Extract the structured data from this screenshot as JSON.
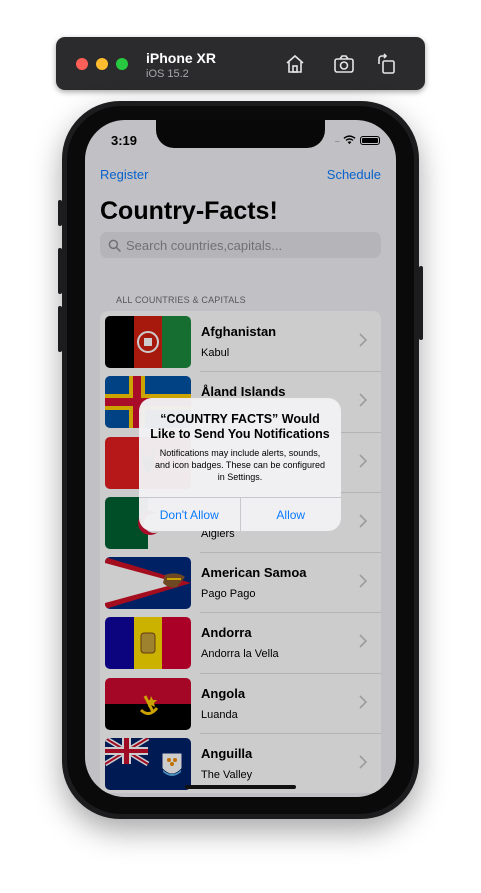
{
  "simulator": {
    "device": "iPhone XR",
    "os": "iOS 15.2",
    "icons": [
      "home-icon",
      "screenshot-icon",
      "rotate-icon"
    ]
  },
  "status_bar": {
    "time": "3:19",
    "signal": "....."
  },
  "nav": {
    "left": "Register",
    "right": "Schedule"
  },
  "title": "Country-Facts!",
  "search": {
    "placeholder": "Search countries,capitals..."
  },
  "section_header": "ALL COUNTRIES & CAPITALS",
  "countries": [
    {
      "name": "Afghanistan",
      "capital": "Kabul"
    },
    {
      "name": "Åland Islands",
      "capital": ""
    },
    {
      "name": "",
      "capital": ""
    },
    {
      "name": "",
      "capital": "Algiers"
    },
    {
      "name": "American Samoa",
      "capital": "Pago Pago"
    },
    {
      "name": "Andorra",
      "capital": "Andorra la Vella"
    },
    {
      "name": "Angola",
      "capital": "Luanda"
    },
    {
      "name": "Anguilla",
      "capital": "The Valley"
    }
  ],
  "alert": {
    "title": "“COUNTRY FACTS” Would Like to Send You Notifications",
    "message": "Notifications may include alerts, sounds, and icon badges. These can be configured in Settings.",
    "deny": "Don't Allow",
    "allow": "Allow"
  },
  "colors": {
    "accent": "#0a7aff",
    "background": "#f2f2f7"
  }
}
